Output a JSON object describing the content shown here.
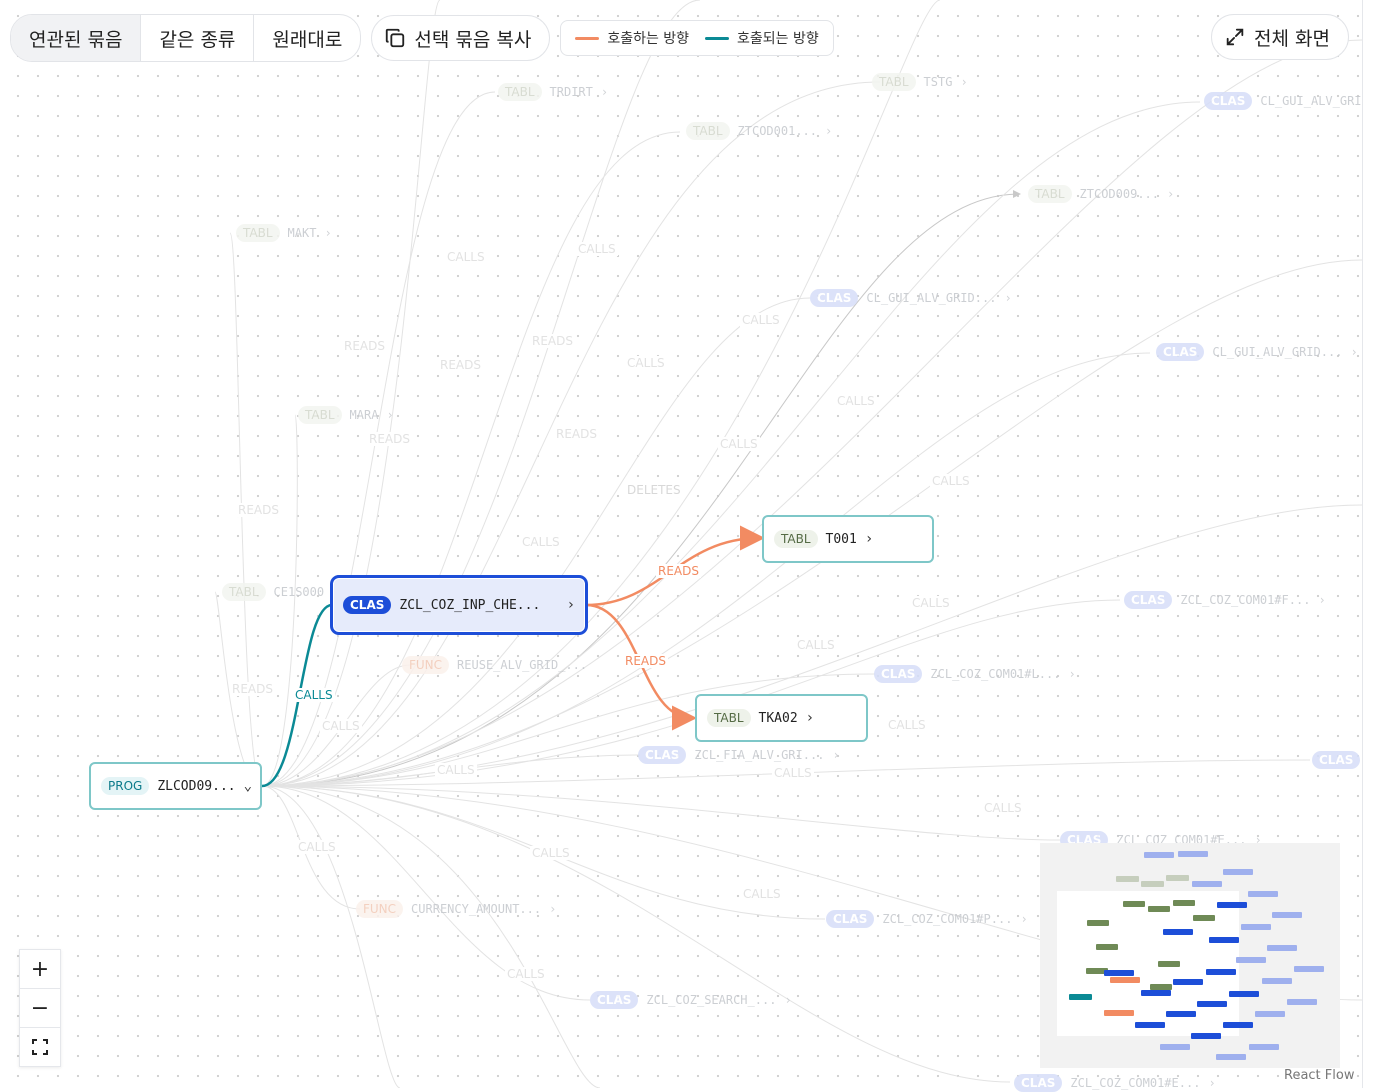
{
  "toolbar": {
    "tabs": [
      {
        "label": "연관된 묶음",
        "active": true
      },
      {
        "label": "같은 종류"
      },
      {
        "label": "원래대로"
      }
    ],
    "copy_button": "선택 묶음 복사",
    "legend": {
      "calling": "호출하는 방향",
      "called": "호출되는 방향"
    },
    "fullscreen_button": "전체 화면"
  },
  "colors": {
    "calling": "#f28b62",
    "called": "#0b8a95",
    "selected": "#1d4ed8"
  },
  "nodes": {
    "prog": {
      "type": "PROG",
      "name": "ZLCOD09..."
    },
    "sel": {
      "type": "CLAS",
      "name": "ZCL_COZ_INP_CHE..."
    },
    "t001": {
      "type": "TABL",
      "name": "T001"
    },
    "tka02": {
      "type": "TABL",
      "name": "TKA02"
    }
  },
  "edges": {
    "calls": "CALLS",
    "reads1": "READS",
    "reads2": "READS"
  },
  "ghost_nodes": [
    {
      "type": "TABL",
      "name": "TRDIRT"
    },
    {
      "type": "TABL",
      "name": "TSTG"
    },
    {
      "type": "TABL",
      "name": "ZTCOD001..."
    },
    {
      "type": "CLAS",
      "name": "CL_GUI_ALV_GRI"
    },
    {
      "type": "TABL",
      "name": "ZTCOD009..."
    },
    {
      "type": "TABL",
      "name": "MAKT"
    },
    {
      "type": "CLAS",
      "name": "CL_GUI_ALV_GRID..."
    },
    {
      "type": "CLAS",
      "name": "CL_GUI_ALV_GRID..."
    },
    {
      "type": "TABL",
      "name": "MARA"
    },
    {
      "type": "TABL",
      "name": "CE1S000"
    },
    {
      "type": "CLAS",
      "name": "ZCL_COZ_COM01#F..."
    },
    {
      "type": "FUNC",
      "name": "REUSE_ALV_GRID_..."
    },
    {
      "type": "CLAS",
      "name": "ZCL_COZ_COM01#L..."
    },
    {
      "type": "CLAS",
      "name": "ZCL_FIA_ALV_GRI..."
    },
    {
      "type": "CLAS",
      "name": ""
    },
    {
      "type": "CLAS",
      "name": "ZCL_COZ_COM01#E..."
    },
    {
      "type": "FUNC",
      "name": "CURRENCY_AMOUNT..."
    },
    {
      "type": "CLAS",
      "name": "ZCL_COZ_COM01#P..."
    },
    {
      "type": "CLAS",
      "name": "ZCL_COZ_SEARCH_..."
    },
    {
      "type": "CLAS",
      "name": "ZCL_COZ_COM01#E..."
    }
  ],
  "ghost_labels": [
    "CALLS",
    "CALLS",
    "READS",
    "READS",
    "READS",
    "CALLS",
    "READS",
    "CALLS",
    "READS",
    "CALLS",
    "DELETES",
    "CALLS",
    "CALLS",
    "READS",
    "CALLS",
    "CALLS",
    "CALLS",
    "READS",
    "CALLS",
    "CALLS",
    "CALLS",
    "CALLS",
    "CALLS",
    "CALLS",
    "CALLS",
    "CALLS",
    "CALLS"
  ],
  "attribution": "React Flow"
}
